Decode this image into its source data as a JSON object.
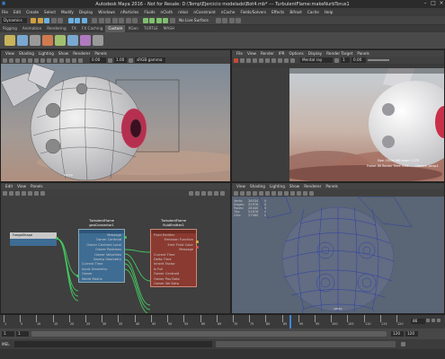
{
  "title": "Autodesk Maya 2016 - Not for Resale: D:\\Temp\\Ejercicio modelado\\Bot4.mb* --- TurbulentFlame:makeNurbTorus1",
  "menu": [
    "File",
    "Edit",
    "Create",
    "Select",
    "Modify",
    "Display",
    "Windows",
    "nParticles",
    "Fluids",
    "nCloth",
    "nHair",
    "nConstraint",
    "nCache",
    "Fields/Solvers",
    "Effects",
    "Bifrost",
    "Cache",
    "Help"
  ],
  "status": {
    "mode": "Dynamics",
    "live": "No Live Surface"
  },
  "shelf_tabs": [
    "Rigging",
    "Animation",
    "Rendering",
    "FX",
    "FX Caching",
    "Custom",
    "XGen",
    "TURTLE",
    "MASH"
  ],
  "shelf_active": "Custom",
  "vp1": {
    "menu": [
      "View",
      "Shading",
      "Lighting",
      "Show",
      "Renderer",
      "Panels"
    ],
    "field_a": "0.00",
    "field_b": "1.00",
    "colorspace": "sRGB gamma",
    "label": "persp"
  },
  "render": {
    "menu": [
      "File",
      "View",
      "Render",
      "IPR",
      "Options",
      "Display",
      "Render Target",
      "Panels"
    ],
    "renderer": "Mental ray",
    "field": "1",
    "field_b": "0.00",
    "info": "Size: 1920x 960  zoom: 0.231",
    "info_b": "Frame: 86   Render Time: 0:04",
    "info_c": "Camera: persp1"
  },
  "node_editor": {
    "menu": [
      "Edit",
      "View",
      "Panels"
    ],
    "nodes": {
      "fuego": {
        "title": "FuegoShape"
      },
      "geo": {
        "title": "TurbulentFlame",
        "subtitle": "geoConnector1",
        "rows": [
          "Message",
          "Owner Centroid",
          "Owner Centroid Local",
          "Owner Positions",
          "Owner Velocities",
          "Sweep Geometry",
          "Current Time",
          "Input Geometry",
          "Owner",
          "World Matrix"
        ]
      },
      "fluid": {
        "title": "TurbulentFlame",
        "subtitle": "fluidEmitter2",
        "rows": [
          "Emission Function",
          "Emit Fluid Color",
          "Message",
          "Current Time",
          "Delta Time",
          "Inherit Factor",
          "Is Full",
          "Owner Centroid",
          "Owner Pos Data",
          "Owner Vel Data"
        ],
        "in_row": "Fluid Emitter"
      }
    }
  },
  "vp4": {
    "menu": [
      "View",
      "Shading",
      "Lighting",
      "Show",
      "Renderer",
      "Panels"
    ],
    "stats": [
      {
        "label": "Verts:",
        "a": "26534",
        "b": "0"
      },
      {
        "label": "Edges:",
        "a": "52976",
        "b": "0"
      },
      {
        "label": "Faces:",
        "a": "26440",
        "b": "0"
      },
      {
        "label": "Tris:",
        "a": "52876",
        "b": "0"
      },
      {
        "label": "UVs:",
        "a": "27060",
        "b": "0"
      }
    ],
    "label": "persp"
  },
  "timeline": {
    "ticks": [
      "1",
      "5",
      "10",
      "15",
      "20",
      "25",
      "30",
      "35",
      "40",
      "45",
      "50",
      "55",
      "60",
      "65",
      "70",
      "75",
      "80",
      "85",
      "90",
      "95",
      "100",
      "105",
      "110",
      "115",
      "120"
    ],
    "current_frame": "86"
  },
  "range": {
    "start": "1",
    "start2": "1",
    "end": "120",
    "end2": "120"
  },
  "command": {
    "lang": "MEL"
  },
  "colors": {
    "accent": "#6fc0e8",
    "node_blue": "#3e6c93",
    "node_red": "#8a3a30",
    "wire_green": "#44c860"
  }
}
